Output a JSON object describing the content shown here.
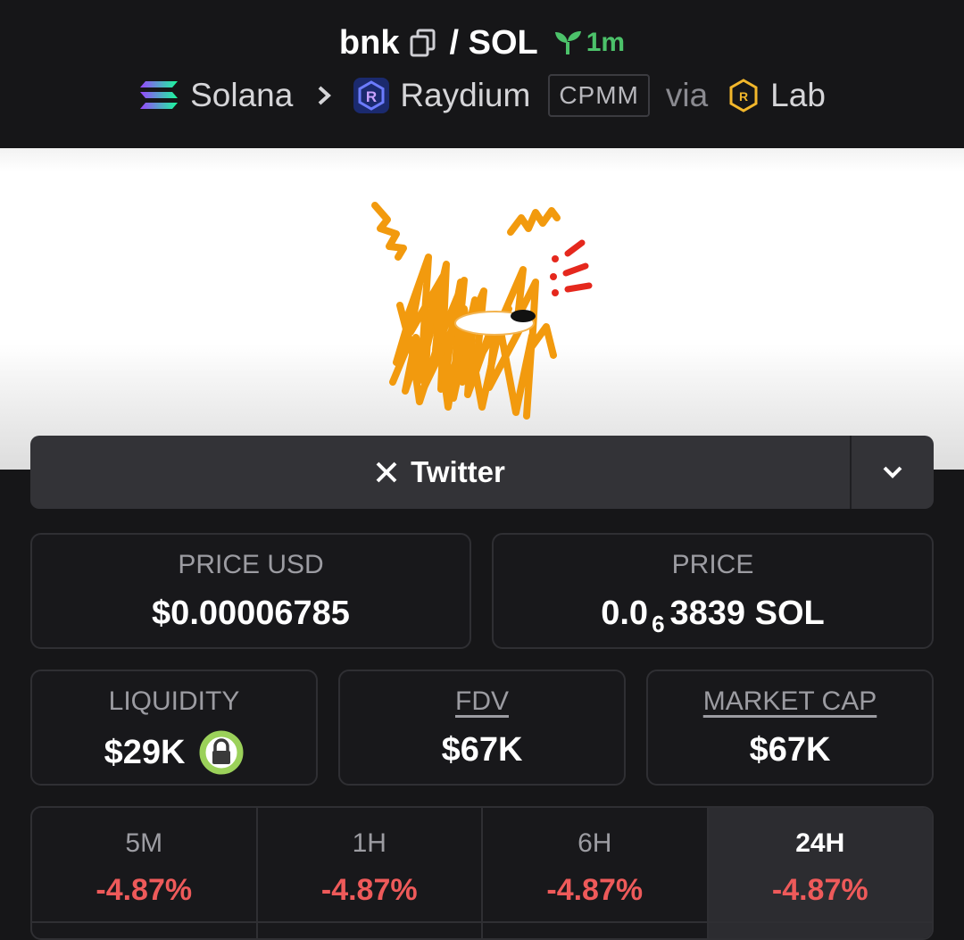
{
  "header": {
    "base_symbol": "bnk",
    "quote_symbol": "/ SOL",
    "age": "1m",
    "chain": "Solana",
    "dex": "Raydium",
    "pool_type": "CPMM",
    "via_label": "via",
    "launchpad": "Lab"
  },
  "socials": {
    "twitter_label": "Twitter"
  },
  "stats": {
    "price_usd_label": "PRICE USD",
    "price_usd_value": "$0.00006785",
    "price_label": "PRICE",
    "price_prefix": "0.0",
    "price_zeros": "6",
    "price_suffix": "3839 SOL",
    "liquidity_label": "LIQUIDITY",
    "liquidity_value": "$29K",
    "fdv_label": "FDV",
    "fdv_value": "$67K",
    "mcap_label": "MARKET CAP",
    "mcap_value": "$67K"
  },
  "timeframes": [
    {
      "label": "5M",
      "value": "-4.87%"
    },
    {
      "label": "1H",
      "value": "-4.87%"
    },
    {
      "label": "6H",
      "value": "-4.87%"
    },
    {
      "label": "24H",
      "value": "-4.87%"
    }
  ],
  "colors": {
    "background": "#161618",
    "card_border": "#2f2f33",
    "negative": "#ee5a5a",
    "age_green": "#4cc26a",
    "lock_green": "#9bd15a",
    "banner_orange": "#f29a0e"
  }
}
